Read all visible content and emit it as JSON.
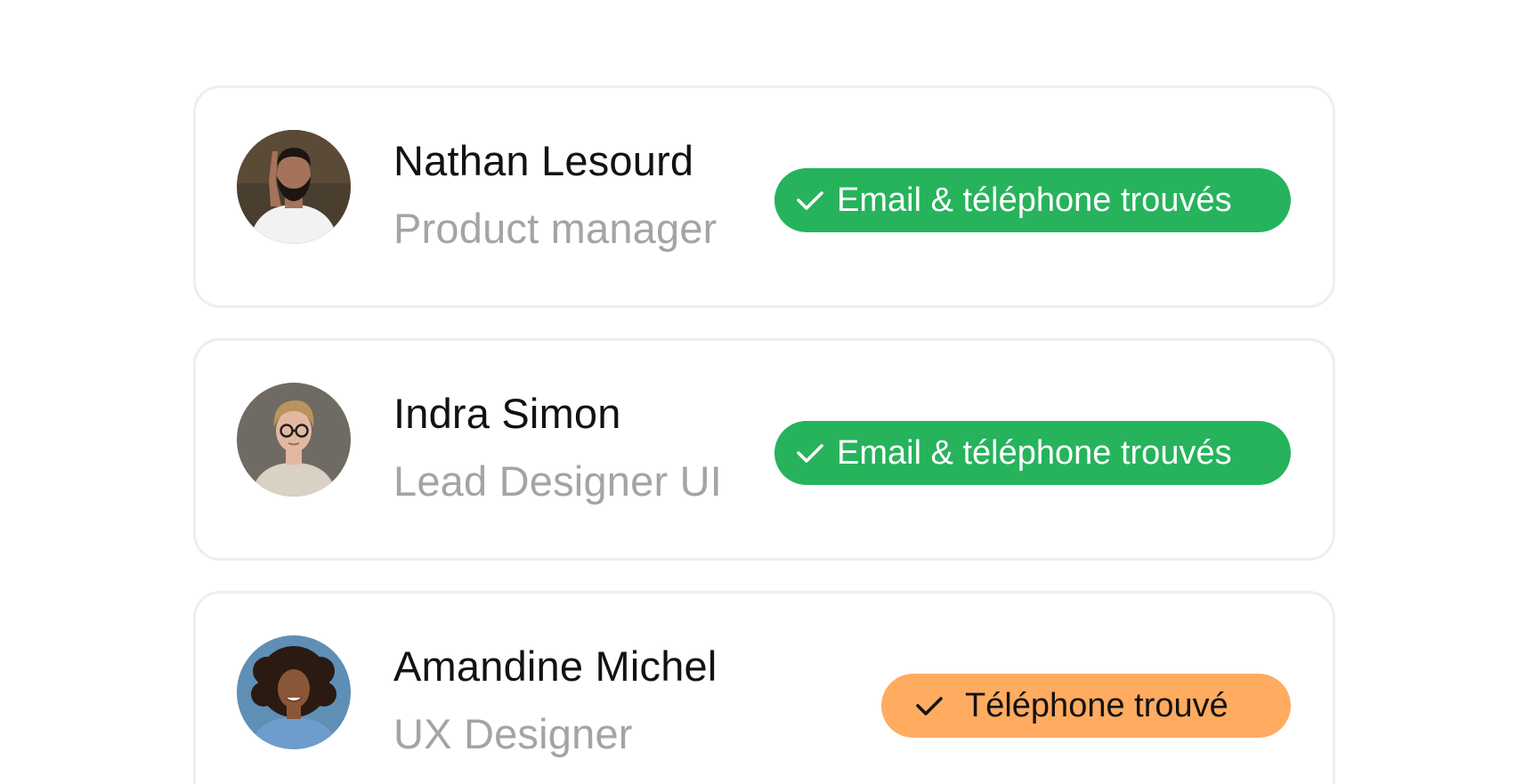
{
  "contacts": [
    {
      "name": "Nathan Lesourd",
      "role": "Product manager",
      "status": {
        "label": "Email & téléphone trouvés",
        "icon": "check-icon",
        "color": "#26b35c",
        "text_color": "#ffffff"
      },
      "avatar": {
        "bg": "#4a3e2e",
        "skin": "#a5735a",
        "hair": "#1c1511",
        "shirt": "#f2f2f2"
      }
    },
    {
      "name": "Indra Simon",
      "role": "Lead Designer UI",
      "status": {
        "label": "Email & téléphone trouvés",
        "icon": "check-icon",
        "color": "#26b35c",
        "text_color": "#ffffff"
      },
      "avatar": {
        "bg": "#6f6a63",
        "skin": "#e2b9a0",
        "hair": "#b8955e",
        "shirt": "#d9d1c3"
      }
    },
    {
      "name": "Amandine Michel",
      "role": "UX Designer",
      "status": {
        "label": "Téléphone trouvé",
        "icon": "check-icon",
        "color": "#ffab60",
        "text_color": "#121212"
      },
      "avatar": {
        "bg": "#5f8fb5",
        "skin": "#8a5638",
        "hair": "#2a1a12",
        "shirt": "#6e9ccc"
      }
    }
  ]
}
